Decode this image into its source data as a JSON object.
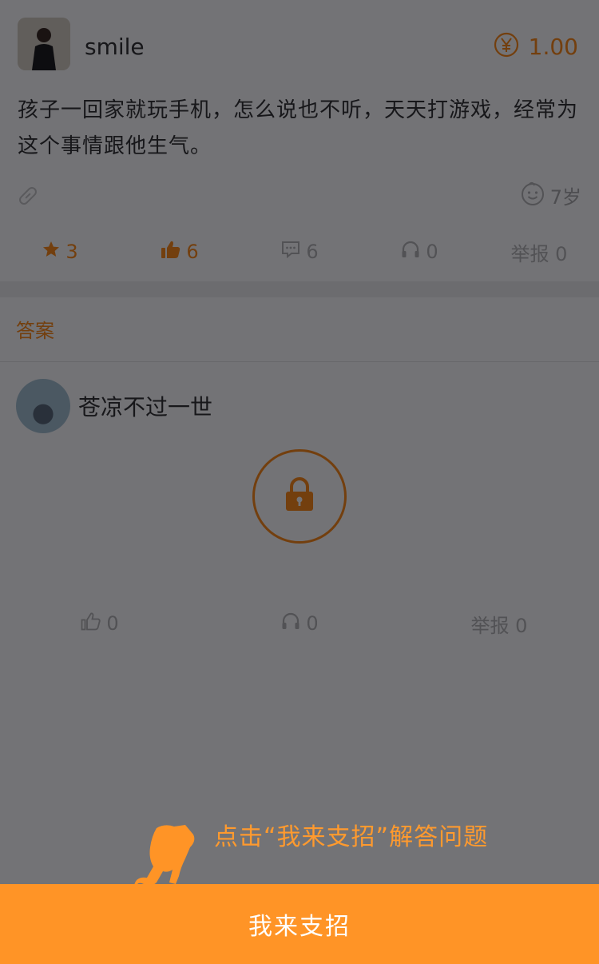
{
  "question": {
    "user_name": "smile",
    "reward": "1.00",
    "text": "孩子一回家就玩手机，怎么说也不听，天天打游戏，经常为这个事情跟他生气。",
    "age": "7岁",
    "actions": {
      "favorites": "3",
      "likes": "6",
      "comments": "6",
      "listens": "0",
      "report": "举报 0"
    }
  },
  "answer_section": {
    "header": "答案",
    "answer": {
      "user_name": "苍凉不过一世",
      "actions": {
        "likes": "0",
        "listens": "0",
        "report": "举报 0"
      }
    }
  },
  "guide": {
    "hint": "点击“我来支招”解答问题"
  },
  "bottom_button": {
    "label": "我来支招"
  },
  "colors": {
    "accent": "#ff9426",
    "accent_text": "#ff8c1a",
    "overlay": "rgba(0,0,5,0.55)"
  }
}
